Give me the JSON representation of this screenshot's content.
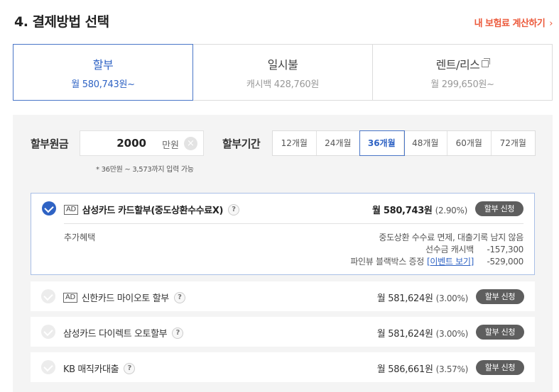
{
  "header": {
    "title": "4. 결제방법 선택",
    "calc_link": "내 보험료 계산하기",
    "calc_chevron": "›"
  },
  "tabs": [
    {
      "name": "할부",
      "sub": "월 580,743원~"
    },
    {
      "name": "일시불",
      "sub": "캐시백 428,760원"
    },
    {
      "name": "렌트/리스",
      "sub": "월 299,650원~"
    }
  ],
  "amount": {
    "label": "할부원금",
    "value": "2000",
    "unit": "만원",
    "clear_symbol": "×",
    "hint": "* 36만원 ~ 3,573까지 입력 가능"
  },
  "period": {
    "label": "할부기간",
    "options": [
      "12개월",
      "24개월",
      "36개월",
      "48개월",
      "60개월",
      "72개월"
    ],
    "selected": "36개월"
  },
  "cards": [
    {
      "ad": "AD",
      "name": "삼성카드 카드할부(중도상환수수료X)",
      "price": "월 580,743원",
      "rate": "(2.90%)",
      "button": "할부 신청",
      "benefit_label": "추가혜택",
      "benefit_line1": "중도상환 수수료 면제, 대출기록 남지 않음",
      "benefit_line2_label": "선수금 캐시백",
      "benefit_line2_amount": "-157,300",
      "benefit_line3_label": "파인뷰 블랙박스 증정",
      "benefit_line3_link": "[이벤트 보기]",
      "benefit_line3_amount": "-529,000"
    },
    {
      "ad": "AD",
      "name": "신한카드 마이오토 할부",
      "price": "월 581,624원",
      "rate": "(3.00%)",
      "button": "할부 신청"
    },
    {
      "name": "삼성카드 다이렉트 오토할부",
      "price": "월 581,624원",
      "rate": "(3.00%)",
      "button": "할부 신청"
    },
    {
      "name": "KB 매직카대출",
      "price": "월 586,661원",
      "rate": "(3.57%)",
      "button": "할부 신청"
    }
  ],
  "help_symbol": "?",
  "colors": {
    "accent": "#2f63c4",
    "link_orange": "#ec5a3c",
    "button_gray": "#5e5e5e"
  }
}
